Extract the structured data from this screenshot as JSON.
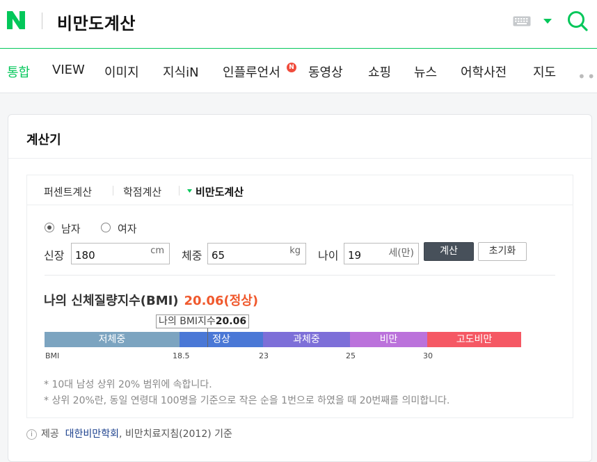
{
  "header": {
    "logo_text": "N",
    "query": "비만도계산",
    "icons": {
      "logo": "naver-logo",
      "keyboard": "keyboard-icon",
      "dropdown": "caret-down-icon",
      "search": "search-icon"
    },
    "brand_color": "#03c75a"
  },
  "tabs": [
    {
      "label": "통합",
      "active": true
    },
    {
      "label": "VIEW"
    },
    {
      "label": "이미지"
    },
    {
      "label": "지식iN"
    },
    {
      "label": "인플루언서",
      "badge": "N"
    },
    {
      "label": "동영상"
    },
    {
      "label": "쇼핑"
    },
    {
      "label": "뉴스"
    },
    {
      "label": "어학사전"
    },
    {
      "label": "지도"
    }
  ],
  "more": "•••",
  "card": {
    "title": "계산기",
    "calc_tabs": [
      "퍼센트계산",
      "학점계산",
      "비만도계산"
    ],
    "active_calc_tab": "비만도계산",
    "gender": {
      "male": "남자",
      "female": "여자",
      "selected": "남자"
    },
    "fields": {
      "height_label": "신장",
      "height_value": "180",
      "height_unit": "cm",
      "weight_label": "체중",
      "weight_value": "65",
      "weight_unit": "kg",
      "age_label": "나이",
      "age_value": "19",
      "age_unit": "세(만)"
    },
    "buttons": {
      "calculate": "계산",
      "reset": "초기화"
    },
    "result": {
      "title": "나의 신체질량지수(BMI)",
      "value_text": "20.06(정상)",
      "pointer_label": "나의 BMI지수",
      "pointer_value": "20.06",
      "bmi": 20.06
    },
    "scale": {
      "segments": [
        {
          "label": "저체중",
          "color": "#7ca4c0"
        },
        {
          "label": "정상",
          "color": "#4a78d6"
        },
        {
          "label": "과체중",
          "color": "#7d6fd8"
        },
        {
          "label": "비만",
          "color": "#bb72db"
        },
        {
          "label": "고도비만",
          "color": "#f55864"
        }
      ],
      "ticks": [
        "BMI",
        "18.5",
        "23",
        "25",
        "30"
      ]
    },
    "notes": [
      "* 10대 남성 상위 20% 범위에 속합니다.",
      "* 상위 20%란, 동일 연령대 100명을 기준으로 작은 순을 1번으로 하였을 때 20번째를 의미합니다."
    ],
    "source": {
      "prefix": "제공",
      "org": "대한비만학회",
      "suffix": ", 비만치료지침(2012) 기준"
    }
  }
}
